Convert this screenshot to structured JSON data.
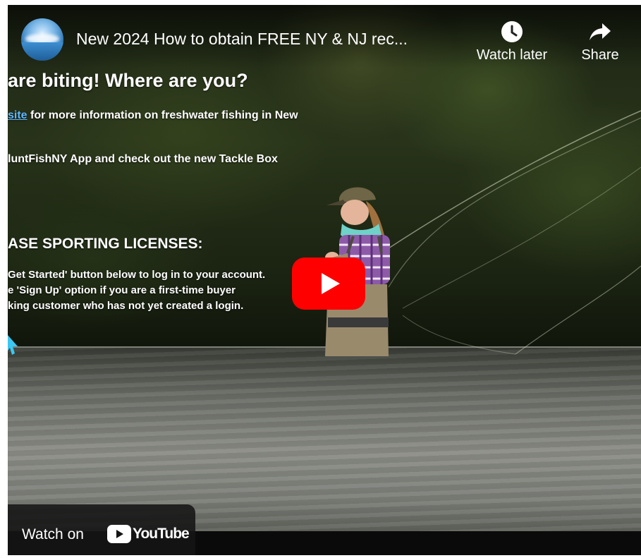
{
  "video": {
    "title": "New 2024 How to obtain FREE NY & NJ rec..."
  },
  "actions": {
    "watch_later": {
      "label": "Watch later",
      "icon": "clock-icon"
    },
    "share": {
      "label": "Share",
      "icon": "share-arrow-icon"
    }
  },
  "slide": {
    "headline": "are biting!  Where are you?",
    "line_a_link": "site",
    "line_a_rest": " for more information on freshwater fishing in New",
    "line_b": "luntFishNY App and check out the new Tackle Box",
    "licenses_heading": "ASE SPORTING LICENSES:",
    "licenses_lines": [
      "Get Started' button below to log in to your account.",
      "e 'Sign Up' option if you are a first-time buyer",
      "king customer who has not yet created a login."
    ]
  },
  "play_button": {
    "icon": "play-icon",
    "color": "#FF0000"
  },
  "watch_on": {
    "label": "Watch on",
    "brand": "YouTube"
  }
}
